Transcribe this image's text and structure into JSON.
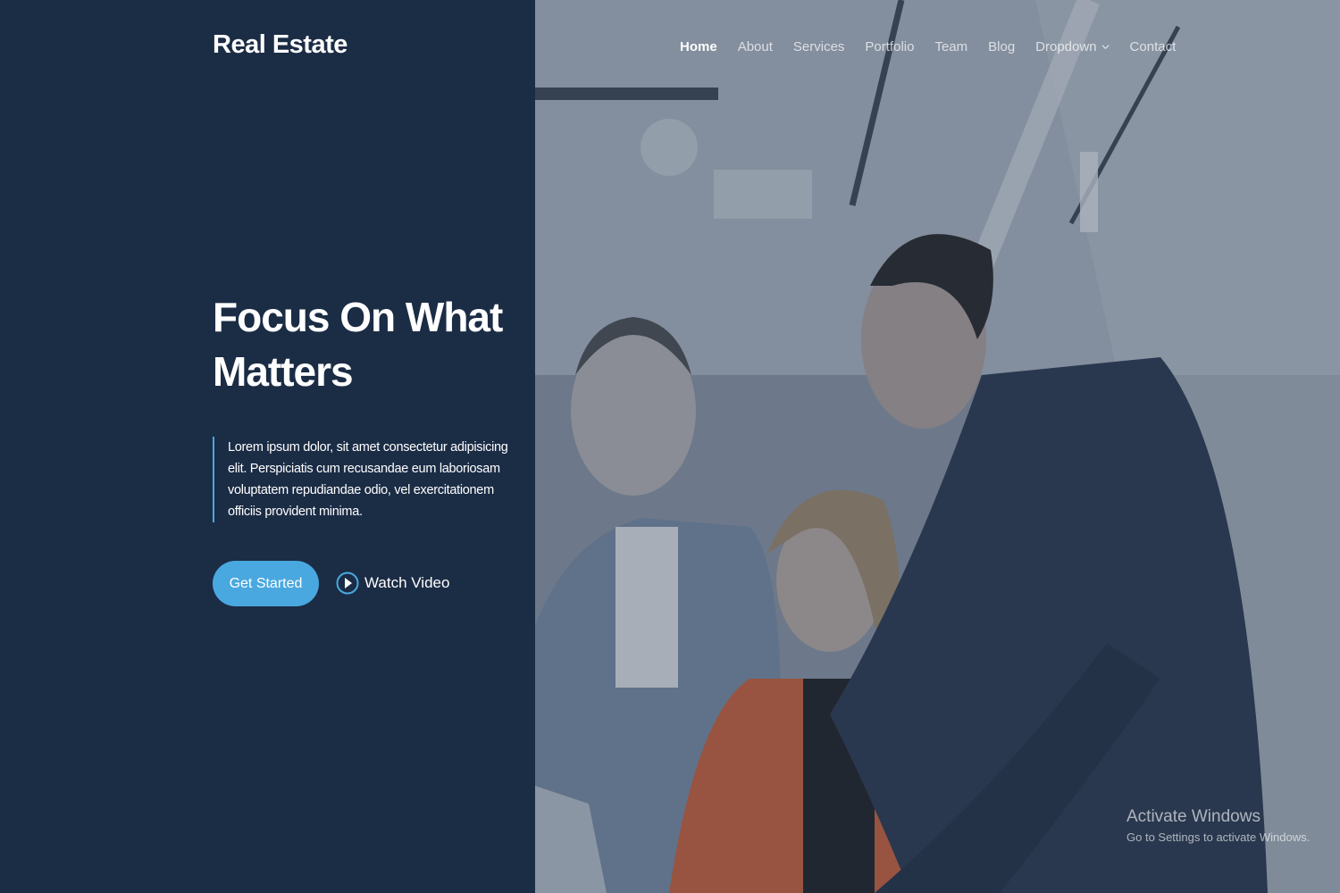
{
  "brand": {
    "logo": "Real Estate"
  },
  "nav": {
    "items": [
      {
        "label": "Home",
        "active": true
      },
      {
        "label": "About",
        "active": false
      },
      {
        "label": "Services",
        "active": false
      },
      {
        "label": "Portfolio",
        "active": false
      },
      {
        "label": "Team",
        "active": false
      },
      {
        "label": "Blog",
        "active": false
      },
      {
        "label": "Dropdown",
        "active": false,
        "has_dropdown": true
      },
      {
        "label": "Contact",
        "active": false
      }
    ]
  },
  "hero": {
    "title_line1": "Focus On What",
    "title_line2": "Matters",
    "description": "Lorem ipsum dolor, sit amet consectetur adipisicing elit. Perspiciatis cum recusandae eum laboriosam voluptatem repudiandae odio, vel exercitationem officiis provident minima.",
    "cta_label": "Get Started",
    "video_label": "Watch Video",
    "image_icon": "team-photo"
  },
  "windows_watermark": {
    "title": "Activate Windows",
    "subtitle": "Go to Settings to activate Windows."
  },
  "colors": {
    "panel_bg": "#1b2c45",
    "accent": "#4aa8e0",
    "text": "#ffffff"
  }
}
